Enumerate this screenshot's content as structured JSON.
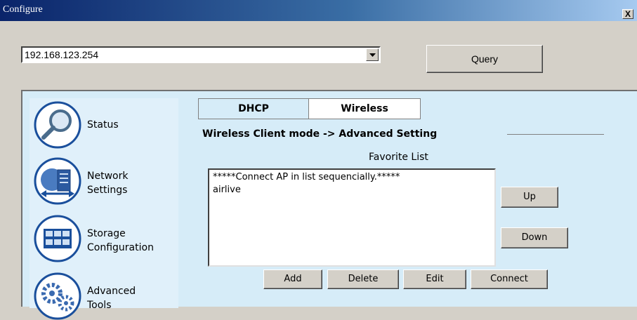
{
  "window": {
    "title": "Configure",
    "close_label": "X"
  },
  "toolbar": {
    "ip_select": {
      "value": "192.168.123.254"
    },
    "query_label": "Query"
  },
  "sidebar": {
    "items": [
      {
        "label": "Status",
        "icon": "magnifier-icon"
      },
      {
        "label": "Network\nSettings",
        "icon": "network-server-icon"
      },
      {
        "label": "Storage\nConfiguration",
        "icon": "storage-grid-icon"
      },
      {
        "label": "Advanced\nTools",
        "icon": "gears-icon"
      }
    ]
  },
  "tabs": [
    {
      "label": "DHCP",
      "active": false
    },
    {
      "label": "Wireless",
      "active": true
    }
  ],
  "section": {
    "title": "Wireless Client mode -> Advanced Setting",
    "favorite_label": "Favorite List",
    "list_items": [
      "*****Connect AP in list sequencially.*****",
      "airlive"
    ]
  },
  "buttons": {
    "up": "Up",
    "down": "Down",
    "add": "Add",
    "delete": "Delete",
    "edit": "Edit",
    "connect": "Connect"
  },
  "colors": {
    "titlebar_start": "#0a246a",
    "panel_bg": "#d6ecf8",
    "icon_blue": "#1a4f9c"
  }
}
